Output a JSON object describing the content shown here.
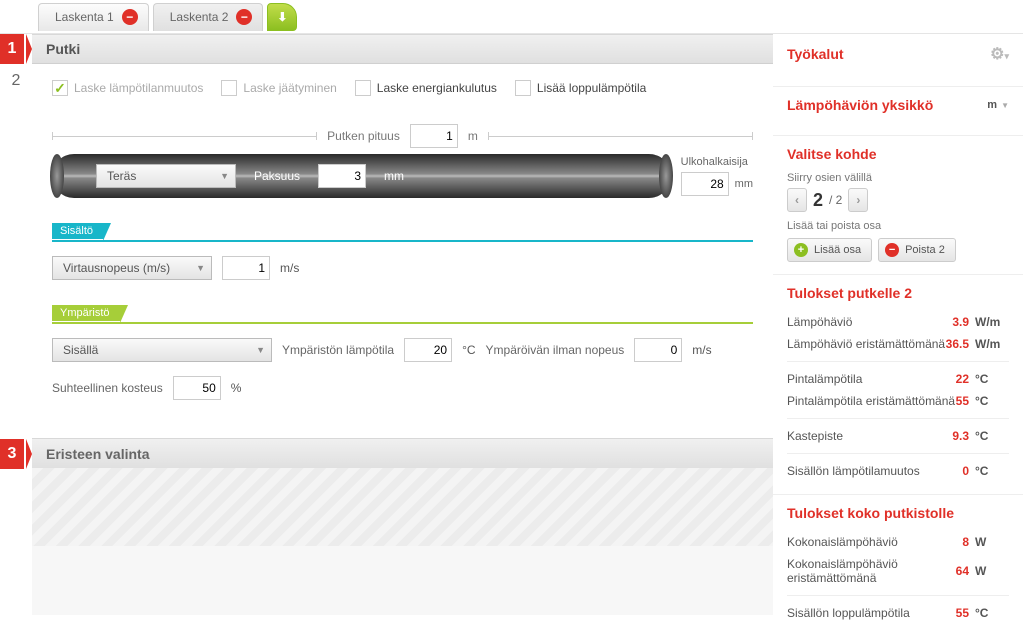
{
  "tabs": {
    "t1": "Laskenta 1",
    "t2": "Laskenta 2"
  },
  "steps": {
    "s1": "1",
    "s2": "2",
    "s3": "3"
  },
  "section1": {
    "title": "Putki"
  },
  "checks": {
    "c1": "Laske lämpötilanmuutos",
    "c2": "Laske jäätyminen",
    "c3": "Laske energiankulutus",
    "c4": "Lisää loppulämpötila"
  },
  "pipe": {
    "len_label": "Putken pituus",
    "len_value": "1",
    "len_unit": "m",
    "material": "Teräs",
    "thick_label": "Paksuus",
    "thick_value": "3",
    "thick_unit": "mm",
    "diam_label": "Ulkohalkaisija",
    "diam_value": "28",
    "diam_unit": "mm"
  },
  "band1": "Sisältö",
  "flow": {
    "mode": "Virtausnopeus (m/s)",
    "value": "1",
    "unit": "m/s"
  },
  "band2": "Ympäristö",
  "env": {
    "location": "Sisällä",
    "temp_label": "Ympäristön lämpötila",
    "temp_value": "20",
    "temp_unit": "°C",
    "air_label": "Ympäröivän ilman nopeus",
    "air_value": "0",
    "air_unit": "m/s",
    "hum_label": "Suhteellinen kosteus",
    "hum_value": "50",
    "hum_unit": "%"
  },
  "section3": {
    "title": "Eristeen valinta"
  },
  "side": {
    "tools": "Työkalut",
    "unit_title": "Lämpöhäviön yksikkö",
    "unit_value": "m",
    "target_title": "Valitse kohde",
    "nav_label": "Siirry osien välillä",
    "nav_cur": "2",
    "nav_sep": "/ 2",
    "addrem_label": "Lisää tai poista osa",
    "btn_add": "Lisää osa",
    "btn_rem": "Poista 2",
    "res_pipe_title": "Tulokset putkelle 2",
    "rows": {
      "r1l": "Lämpöhäviö",
      "r1v": "3.9",
      "r1u": "W/m",
      "r2l": "Lämpöhäviö eristämättömänä",
      "r2v": "36.5",
      "r2u": "W/m",
      "r3l": "Pintalämpötila",
      "r3v": "22",
      "r3u": "°C",
      "r4l": "Pintalämpötila eristämättömänä",
      "r4v": "55",
      "r4u": "°C",
      "r5l": "Kastepiste",
      "r5v": "9.3",
      "r5u": "°C",
      "r6l": "Sisällön lämpötilamuutos",
      "r6v": "0",
      "r6u": "°C"
    },
    "res_all_title": "Tulokset koko putkistolle",
    "trows": {
      "t1l": "Kokonaislämpöhäviö",
      "t1v": "8",
      "t1u": "W",
      "t2l": "Kokonaislämpöhäviö eristämättömänä",
      "t2v": "64",
      "t2u": "W",
      "t3l": "Sisällön loppulämpötila",
      "t3v": "55",
      "t3u": "°C"
    }
  }
}
